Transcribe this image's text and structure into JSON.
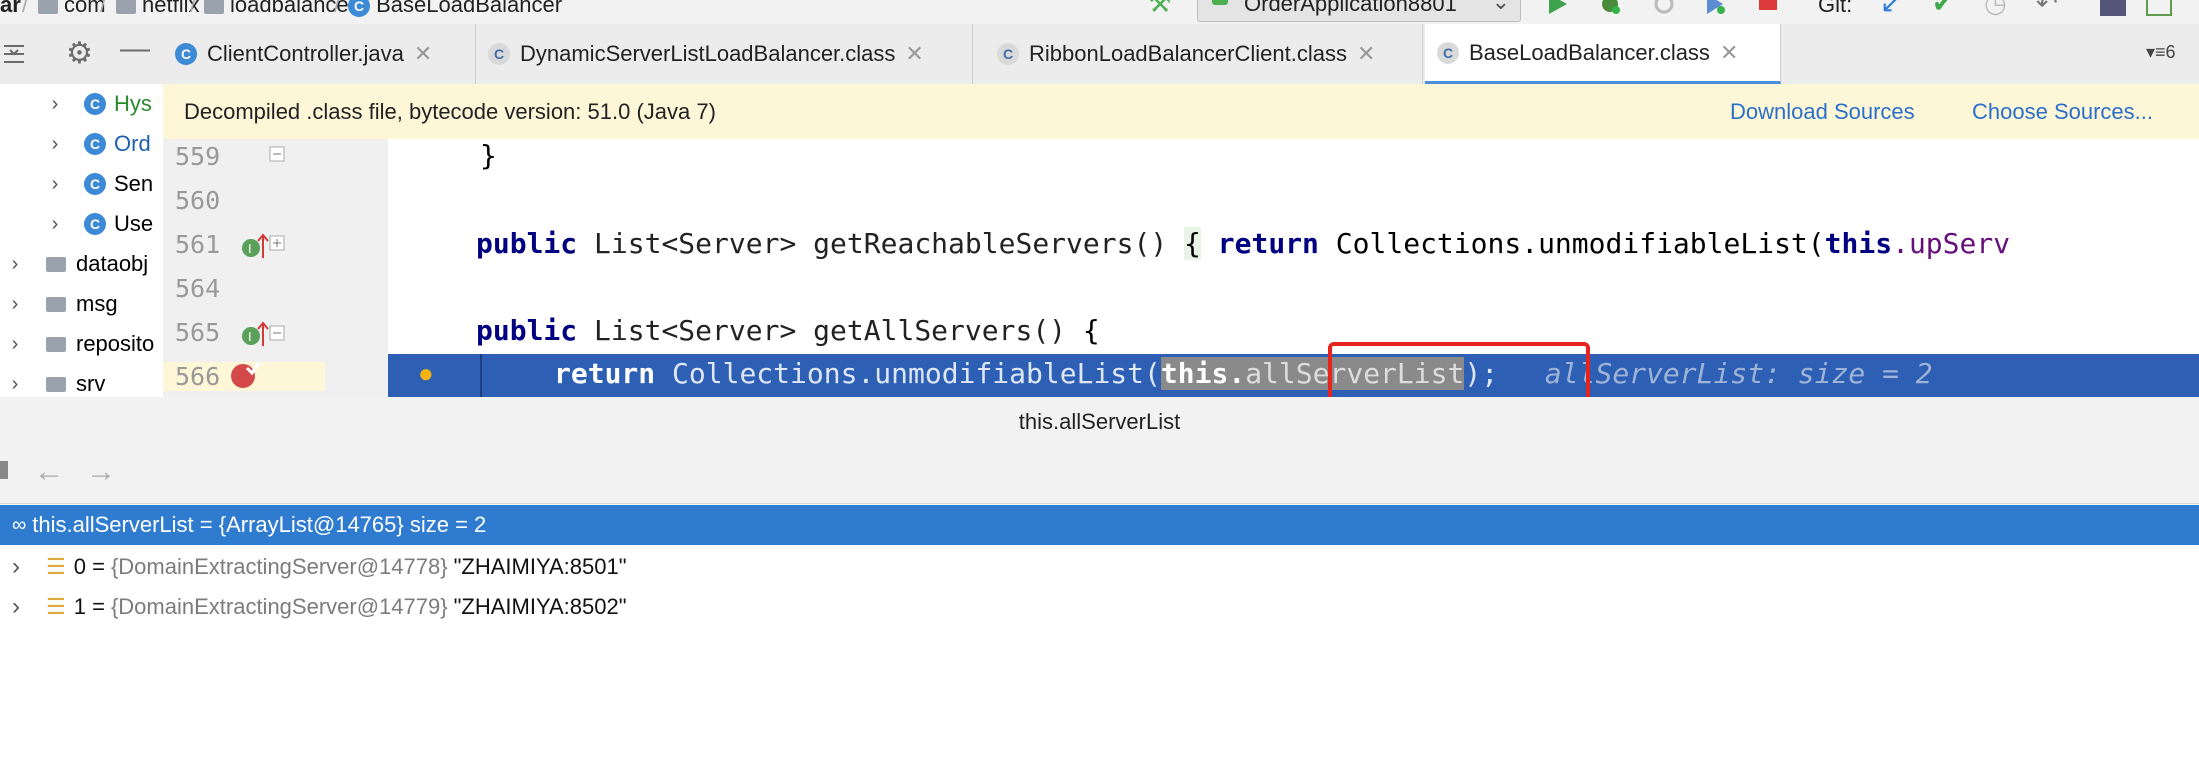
{
  "breadcrumbs": [
    "ar",
    "com",
    "netflix",
    "loadbalancer",
    "BaseLoadBalancer"
  ],
  "run_config": "OrderApplication8801",
  "git_label": "Git:",
  "tabs": [
    {
      "label": "ClientController.java",
      "active": false
    },
    {
      "label": "DynamicServerListLoadBalancer.class",
      "active": false
    },
    {
      "label": "RibbonLoadBalancerClient.class",
      "active": false
    },
    {
      "label": "BaseLoadBalancer.class",
      "active": true
    }
  ],
  "tab_overflow": "6",
  "sidebar": {
    "items": [
      {
        "label": "Hys",
        "kind": "class",
        "color": "#2b8a2b"
      },
      {
        "label": "Ord",
        "kind": "class",
        "color": "#1f5fb0"
      },
      {
        "label": "Sen",
        "kind": "class",
        "color": "#222222"
      },
      {
        "label": "Use",
        "kind": "class",
        "color": "#222222"
      },
      {
        "label": "dataobj",
        "kind": "folder",
        "color": "#222222"
      },
      {
        "label": "msg",
        "kind": "folder",
        "color": "#222222"
      },
      {
        "label": "reposito",
        "kind": "folder",
        "color": "#222222"
      },
      {
        "label": "srv",
        "kind": "folder",
        "color": "#222222"
      }
    ]
  },
  "banner": {
    "text": "Decompiled .class file, bytecode version: 51.0 (Java 7)",
    "download": "Download Sources",
    "choose": "Choose Sources..."
  },
  "lines": [
    "559",
    "560",
    "561",
    "564",
    "565",
    "566"
  ],
  "code": {
    "l559": "}",
    "l561_kw": "public",
    "l561_type": "List<Server>",
    "l561_name": "getReachableServers()",
    "l561_brace": "{",
    "l561_ret": "return",
    "l561_rest": "Collections.unmodifiableList(",
    "l561_this": "this",
    "l561_tail": ".upServ",
    "l565_kw": "public",
    "l565_type": "List<Server>",
    "l565_name": "getAllServers()",
    "l565_brace": "{",
    "l566_ret": "return",
    "l566_call": "Collections.unmodifiableList(",
    "l566_this": "this.",
    "l566_field": "allServerList",
    "l566_end": ");",
    "l566_hint": "allServerList:  size = 2"
  },
  "debug": {
    "title": "this.allServerList",
    "root": "this.allServerList = {ArrayList@14765}  size = 2",
    "children": [
      {
        "index": "0 =",
        "type": "{DomainExtractingServer@14778}",
        "value": "\"ZHAIMIYA:8501\""
      },
      {
        "index": "1 =",
        "type": "{DomainExtractingServer@14779}",
        "value": "\"ZHAIMIYA:8502\""
      }
    ]
  },
  "colors": {
    "highlight": "#2d5fb5",
    "selection": "#2e7bcf",
    "annotation_box": "#e8231d",
    "banner": "#fdf7d8"
  }
}
